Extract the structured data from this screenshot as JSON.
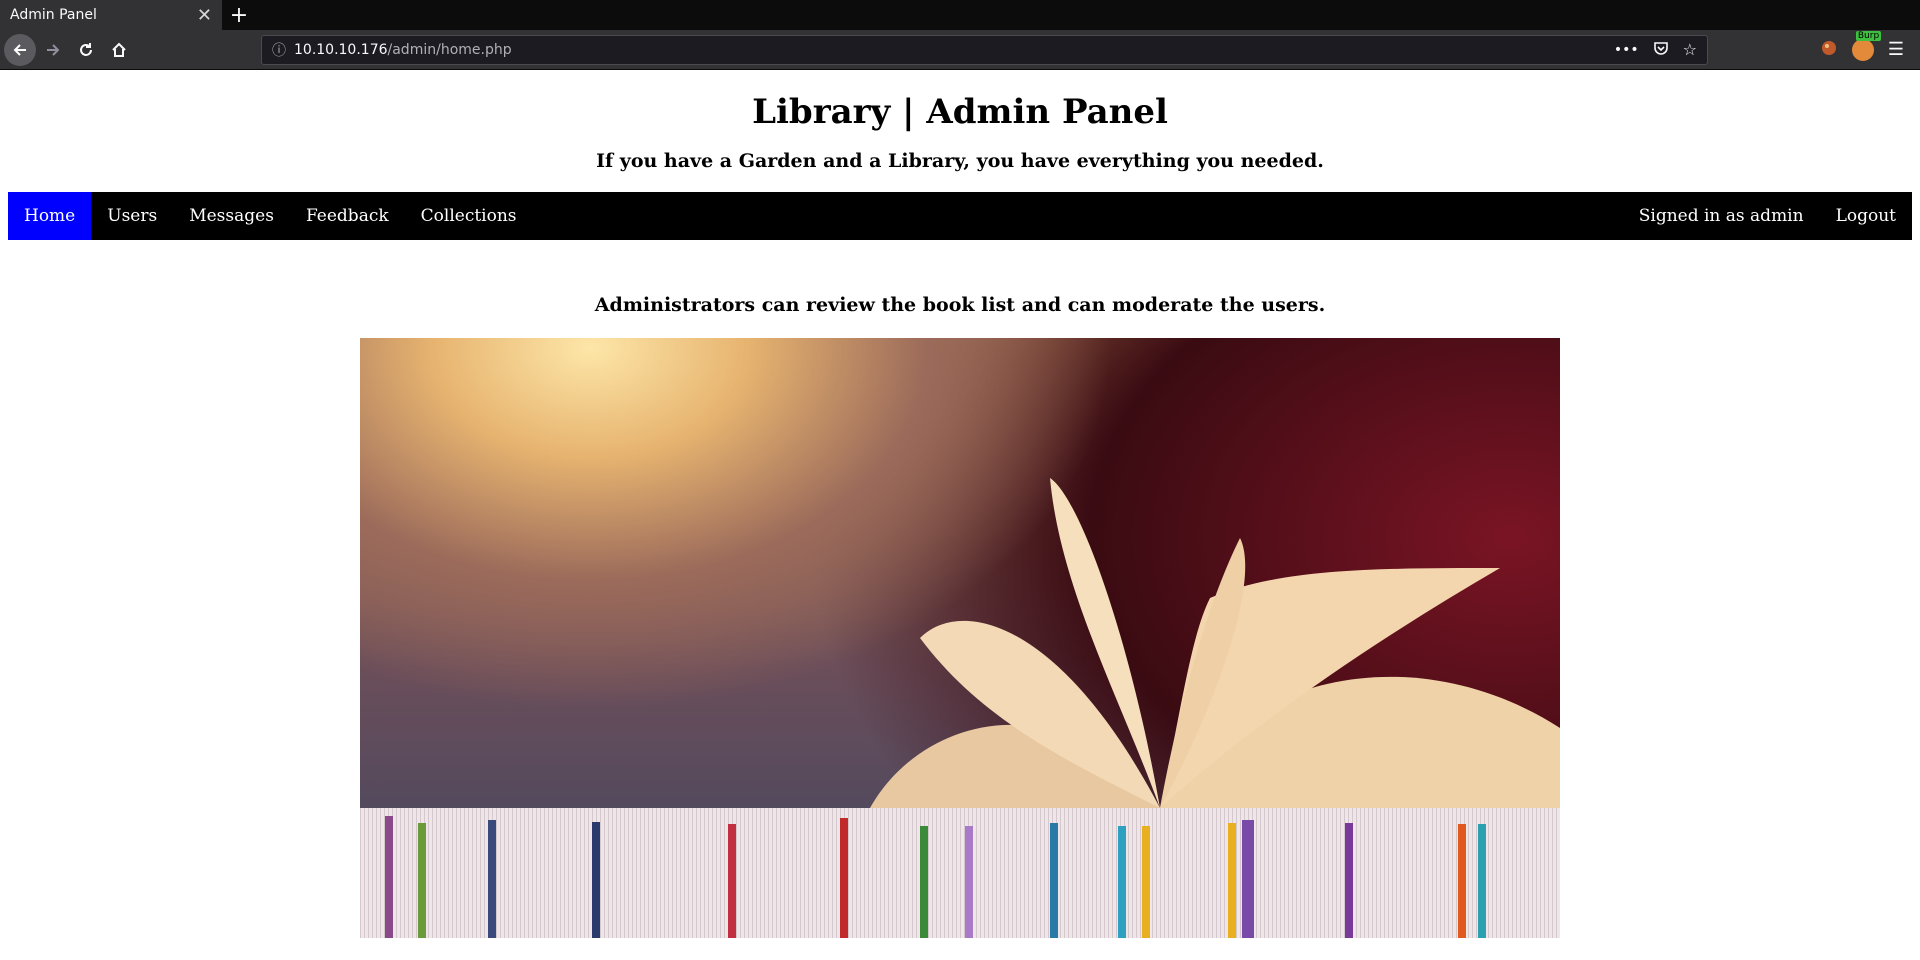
{
  "browser": {
    "tab_title": "Admin Panel",
    "url_host": "10.10.10.176",
    "url_path": "/admin/home.php",
    "burp_label": "Burp"
  },
  "site": {
    "title": "Library | Admin Panel",
    "subtitle": "If you have a Garden and a Library, you have everything you needed.",
    "nav": {
      "home": "Home",
      "users": "Users",
      "messages": "Messages",
      "feedback": "Feedback",
      "collections": "Collections",
      "signed_in": "Signed in as admin",
      "logout": "Logout"
    },
    "lead": "Administrators can review the book list and can moderate the users.",
    "colors": {
      "nav_bg": "#000000",
      "nav_active": "#0000ff"
    }
  },
  "icons": [
    "back-icon",
    "forward-icon",
    "reload-icon",
    "home-icon",
    "info-icon",
    "more-icon",
    "pocket-icon",
    "bookmark-star-icon",
    "extension-icon",
    "burp-icon",
    "menu-icon",
    "plus-icon",
    "close-icon"
  ]
}
